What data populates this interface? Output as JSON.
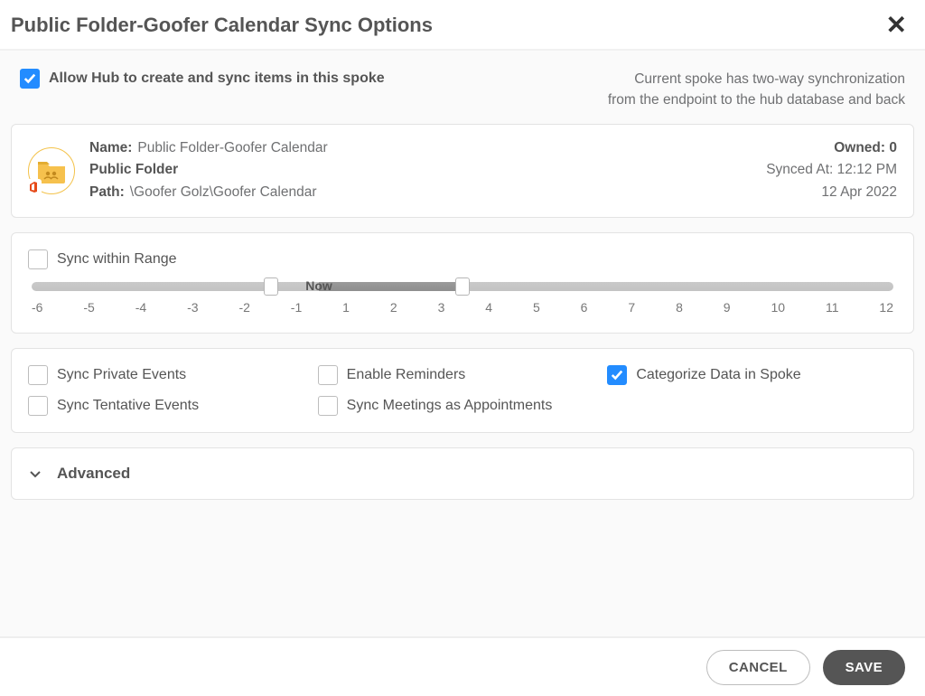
{
  "dialog": {
    "title": "Public Folder-Goofer Calendar Sync Options"
  },
  "allow_hub": {
    "label": "Allow Hub to create and sync items in this spoke",
    "checked": true
  },
  "spoke_desc": {
    "line1": "Current spoke has two-way synchronization",
    "line2": "from the endpoint to the hub database and back"
  },
  "info": {
    "name_label": "Name:",
    "name_value": "Public Folder-Goofer Calendar",
    "type_value": "Public Folder",
    "path_label": "Path:",
    "path_value": "\\Goofer Golz\\Goofer Calendar",
    "owned_label": "Owned:",
    "owned_value": "0",
    "synced_label": "Synced At:",
    "synced_time": "12:12 PM",
    "synced_date": "12 Apr 2022"
  },
  "range": {
    "label": "Sync within Range",
    "checked": false,
    "now_label": "Now",
    "min": -6,
    "max": 12,
    "from": -1,
    "to": 3,
    "ticks": [
      "-6",
      "-5",
      "-4",
      "-3",
      "-2",
      "-1",
      "1",
      "2",
      "3",
      "4",
      "5",
      "6",
      "7",
      "8",
      "9",
      "10",
      "11",
      "12"
    ]
  },
  "options": {
    "sync_private": {
      "label": "Sync Private Events",
      "checked": false
    },
    "enable_reminders": {
      "label": "Enable Reminders",
      "checked": false
    },
    "categorize": {
      "label": "Categorize Data in Spoke",
      "checked": true
    },
    "sync_tentative": {
      "label": "Sync Tentative Events",
      "checked": false
    },
    "sync_meetings": {
      "label": "Sync Meetings as Appointments",
      "checked": false
    }
  },
  "advanced": {
    "label": "Advanced"
  },
  "footer": {
    "cancel": "CANCEL",
    "save": "SAVE"
  }
}
